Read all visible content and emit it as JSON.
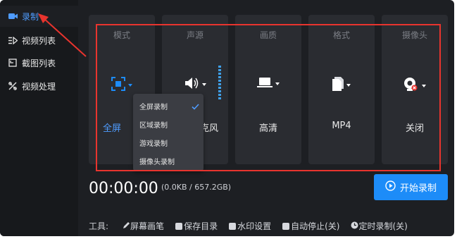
{
  "sidebar": {
    "items": [
      {
        "label": "录制",
        "icon": "video-camera-icon",
        "active": true
      },
      {
        "label": "视频列表",
        "icon": "video-list-icon",
        "active": false
      },
      {
        "label": "截图列表",
        "icon": "screenshot-list-icon",
        "active": false
      },
      {
        "label": "视频处理",
        "icon": "video-tools-icon",
        "active": false
      }
    ]
  },
  "panels": [
    {
      "title": "模式",
      "value": "全屏",
      "icon": "fullscreen-icon"
    },
    {
      "title": "声源",
      "value": "克风",
      "icon": "speaker-icon"
    },
    {
      "title": "画质",
      "value": "高清",
      "icon": "laptop-icon"
    },
    {
      "title": "格式",
      "value": "MP4",
      "icon": "file-icon"
    },
    {
      "title": "摄像头",
      "value": "关闭",
      "icon": "webcam-off-icon"
    }
  ],
  "mode_dropdown": {
    "options": [
      "全屏录制",
      "区域录制",
      "游戏录制",
      "摄像头录制"
    ],
    "selected": "全屏录制"
  },
  "recording": {
    "timer": "00:00:00",
    "size": "(0.0KB / 657.2GB)",
    "start_label": "开始录制"
  },
  "tools": {
    "label": "工具:",
    "items": [
      "屏幕画笔",
      "保存目录",
      "水印设置",
      "自动停止(关)",
      "定时录制(关)"
    ]
  },
  "colors": {
    "accent": "#1d8cf8",
    "highlight_frame": "#e8342e",
    "background": "#1d1f23"
  }
}
